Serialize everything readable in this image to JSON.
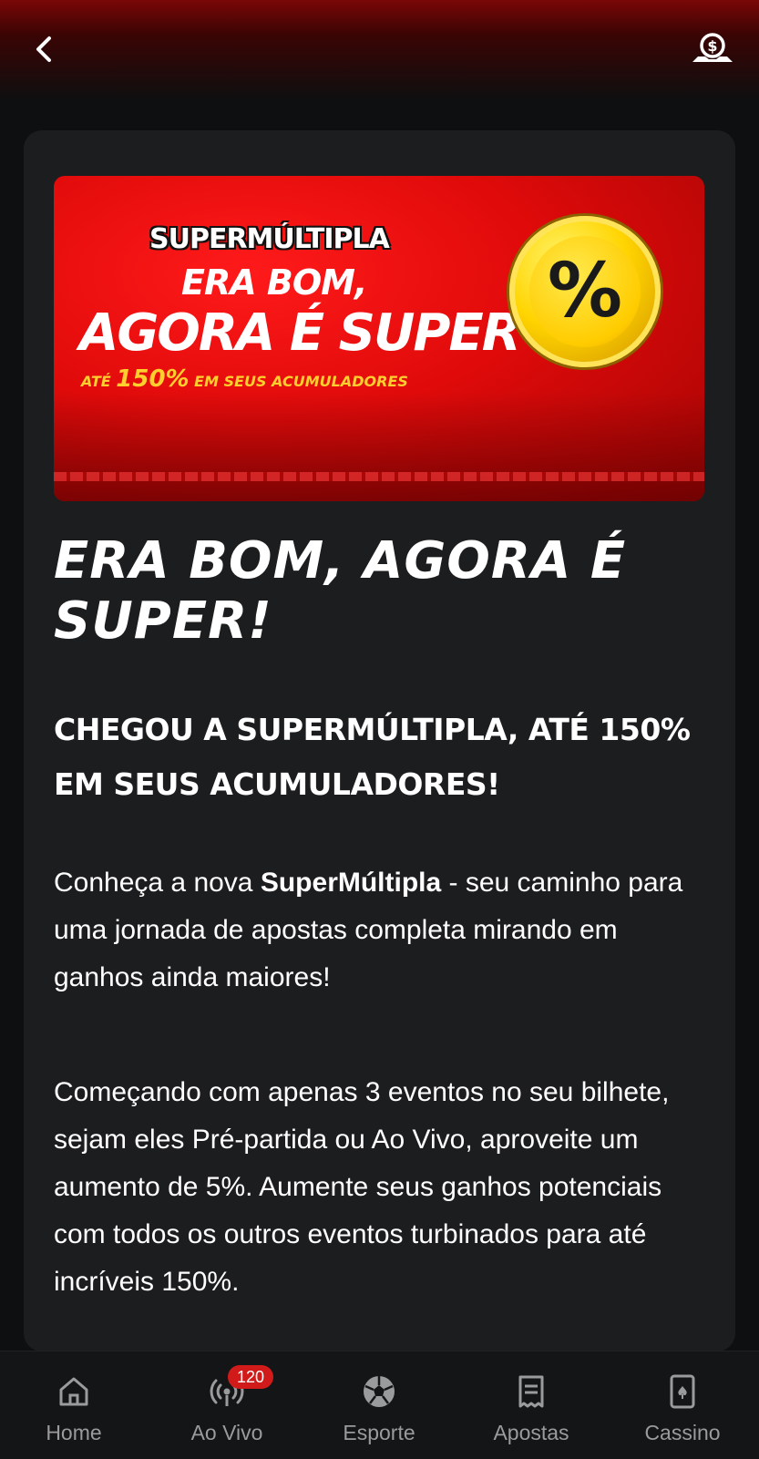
{
  "header": {
    "back_icon": "chevron-left-icon",
    "wallet_icon": "coin-hand-icon"
  },
  "banner": {
    "brand": "SUPERMÚLTIPLA",
    "line1": "ERA BOM,",
    "line2": "AGORA É SUPER",
    "line3_prefix": "ATÉ ",
    "line3_highlight": "150%",
    "line3_suffix": " EM SEUS ACUMULADORES",
    "coin_symbol": "%"
  },
  "article": {
    "title": "ERA BOM, AGORA É SUPER!",
    "subtitle": "CHEGOU A SUPERMÚLTIPLA, ATÉ 150% EM SEUS ACUMULADORES!",
    "para1_prefix": "Conheça a nova ",
    "para1_bold": "SuperMúltipla",
    "para1_suffix": " - seu caminho para uma jornada de apostas completa mirando em ganhos ainda maiores!",
    "para2": "Começando com apenas 3 eventos no seu bilhete, sejam eles Pré-partida ou Ao Vivo, aproveite um aumento de 5%. Aumente seus ganhos potenciais com todos os outros eventos turbinados para até incríveis 150%."
  },
  "bottom_nav": {
    "items": [
      {
        "label": "Home",
        "icon": "home-icon"
      },
      {
        "label": "Ao Vivo",
        "icon": "live-broadcast-icon",
        "badge": "120"
      },
      {
        "label": "Esporte",
        "icon": "soccer-ball-icon"
      },
      {
        "label": "Apostas",
        "icon": "bet-slip-icon"
      },
      {
        "label": "Cassino",
        "icon": "playing-card-icon"
      }
    ]
  },
  "colors": {
    "accent_red": "#e00a0a",
    "badge_red": "#d11b1b",
    "coin_yellow": "#ffd400",
    "card_bg": "#1c1d1f"
  }
}
